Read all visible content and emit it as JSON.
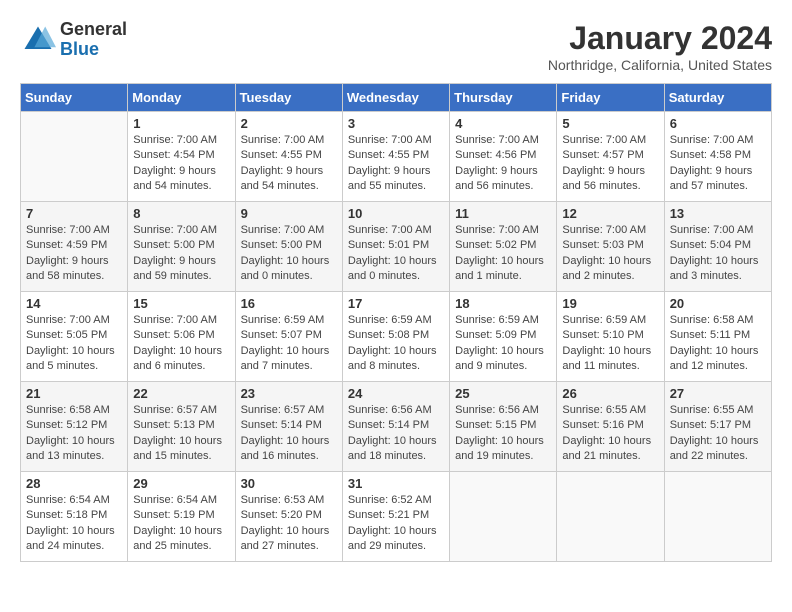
{
  "header": {
    "logo_general": "General",
    "logo_blue": "Blue",
    "month_title": "January 2024",
    "location": "Northridge, California, United States"
  },
  "days_of_week": [
    "Sunday",
    "Monday",
    "Tuesday",
    "Wednesday",
    "Thursday",
    "Friday",
    "Saturday"
  ],
  "weeks": [
    [
      {
        "day": "",
        "sunrise": "",
        "sunset": "",
        "daylight": ""
      },
      {
        "day": "1",
        "sunrise": "Sunrise: 7:00 AM",
        "sunset": "Sunset: 4:54 PM",
        "daylight": "Daylight: 9 hours and 54 minutes."
      },
      {
        "day": "2",
        "sunrise": "Sunrise: 7:00 AM",
        "sunset": "Sunset: 4:55 PM",
        "daylight": "Daylight: 9 hours and 54 minutes."
      },
      {
        "day": "3",
        "sunrise": "Sunrise: 7:00 AM",
        "sunset": "Sunset: 4:55 PM",
        "daylight": "Daylight: 9 hours and 55 minutes."
      },
      {
        "day": "4",
        "sunrise": "Sunrise: 7:00 AM",
        "sunset": "Sunset: 4:56 PM",
        "daylight": "Daylight: 9 hours and 56 minutes."
      },
      {
        "day": "5",
        "sunrise": "Sunrise: 7:00 AM",
        "sunset": "Sunset: 4:57 PM",
        "daylight": "Daylight: 9 hours and 56 minutes."
      },
      {
        "day": "6",
        "sunrise": "Sunrise: 7:00 AM",
        "sunset": "Sunset: 4:58 PM",
        "daylight": "Daylight: 9 hours and 57 minutes."
      }
    ],
    [
      {
        "day": "7",
        "sunrise": "Sunrise: 7:00 AM",
        "sunset": "Sunset: 4:59 PM",
        "daylight": "Daylight: 9 hours and 58 minutes."
      },
      {
        "day": "8",
        "sunrise": "Sunrise: 7:00 AM",
        "sunset": "Sunset: 5:00 PM",
        "daylight": "Daylight: 9 hours and 59 minutes."
      },
      {
        "day": "9",
        "sunrise": "Sunrise: 7:00 AM",
        "sunset": "Sunset: 5:00 PM",
        "daylight": "Daylight: 10 hours and 0 minutes."
      },
      {
        "day": "10",
        "sunrise": "Sunrise: 7:00 AM",
        "sunset": "Sunset: 5:01 PM",
        "daylight": "Daylight: 10 hours and 0 minutes."
      },
      {
        "day": "11",
        "sunrise": "Sunrise: 7:00 AM",
        "sunset": "Sunset: 5:02 PM",
        "daylight": "Daylight: 10 hours and 1 minute."
      },
      {
        "day": "12",
        "sunrise": "Sunrise: 7:00 AM",
        "sunset": "Sunset: 5:03 PM",
        "daylight": "Daylight: 10 hours and 2 minutes."
      },
      {
        "day": "13",
        "sunrise": "Sunrise: 7:00 AM",
        "sunset": "Sunset: 5:04 PM",
        "daylight": "Daylight: 10 hours and 3 minutes."
      }
    ],
    [
      {
        "day": "14",
        "sunrise": "Sunrise: 7:00 AM",
        "sunset": "Sunset: 5:05 PM",
        "daylight": "Daylight: 10 hours and 5 minutes."
      },
      {
        "day": "15",
        "sunrise": "Sunrise: 7:00 AM",
        "sunset": "Sunset: 5:06 PM",
        "daylight": "Daylight: 10 hours and 6 minutes."
      },
      {
        "day": "16",
        "sunrise": "Sunrise: 6:59 AM",
        "sunset": "Sunset: 5:07 PM",
        "daylight": "Daylight: 10 hours and 7 minutes."
      },
      {
        "day": "17",
        "sunrise": "Sunrise: 6:59 AM",
        "sunset": "Sunset: 5:08 PM",
        "daylight": "Daylight: 10 hours and 8 minutes."
      },
      {
        "day": "18",
        "sunrise": "Sunrise: 6:59 AM",
        "sunset": "Sunset: 5:09 PM",
        "daylight": "Daylight: 10 hours and 9 minutes."
      },
      {
        "day": "19",
        "sunrise": "Sunrise: 6:59 AM",
        "sunset": "Sunset: 5:10 PM",
        "daylight": "Daylight: 10 hours and 11 minutes."
      },
      {
        "day": "20",
        "sunrise": "Sunrise: 6:58 AM",
        "sunset": "Sunset: 5:11 PM",
        "daylight": "Daylight: 10 hours and 12 minutes."
      }
    ],
    [
      {
        "day": "21",
        "sunrise": "Sunrise: 6:58 AM",
        "sunset": "Sunset: 5:12 PM",
        "daylight": "Daylight: 10 hours and 13 minutes."
      },
      {
        "day": "22",
        "sunrise": "Sunrise: 6:57 AM",
        "sunset": "Sunset: 5:13 PM",
        "daylight": "Daylight: 10 hours and 15 minutes."
      },
      {
        "day": "23",
        "sunrise": "Sunrise: 6:57 AM",
        "sunset": "Sunset: 5:14 PM",
        "daylight": "Daylight: 10 hours and 16 minutes."
      },
      {
        "day": "24",
        "sunrise": "Sunrise: 6:56 AM",
        "sunset": "Sunset: 5:14 PM",
        "daylight": "Daylight: 10 hours and 18 minutes."
      },
      {
        "day": "25",
        "sunrise": "Sunrise: 6:56 AM",
        "sunset": "Sunset: 5:15 PM",
        "daylight": "Daylight: 10 hours and 19 minutes."
      },
      {
        "day": "26",
        "sunrise": "Sunrise: 6:55 AM",
        "sunset": "Sunset: 5:16 PM",
        "daylight": "Daylight: 10 hours and 21 minutes."
      },
      {
        "day": "27",
        "sunrise": "Sunrise: 6:55 AM",
        "sunset": "Sunset: 5:17 PM",
        "daylight": "Daylight: 10 hours and 22 minutes."
      }
    ],
    [
      {
        "day": "28",
        "sunrise": "Sunrise: 6:54 AM",
        "sunset": "Sunset: 5:18 PM",
        "daylight": "Daylight: 10 hours and 24 minutes."
      },
      {
        "day": "29",
        "sunrise": "Sunrise: 6:54 AM",
        "sunset": "Sunset: 5:19 PM",
        "daylight": "Daylight: 10 hours and 25 minutes."
      },
      {
        "day": "30",
        "sunrise": "Sunrise: 6:53 AM",
        "sunset": "Sunset: 5:20 PM",
        "daylight": "Daylight: 10 hours and 27 minutes."
      },
      {
        "day": "31",
        "sunrise": "Sunrise: 6:52 AM",
        "sunset": "Sunset: 5:21 PM",
        "daylight": "Daylight: 10 hours and 29 minutes."
      },
      {
        "day": "",
        "sunrise": "",
        "sunset": "",
        "daylight": ""
      },
      {
        "day": "",
        "sunrise": "",
        "sunset": "",
        "daylight": ""
      },
      {
        "day": "",
        "sunrise": "",
        "sunset": "",
        "daylight": ""
      }
    ]
  ]
}
